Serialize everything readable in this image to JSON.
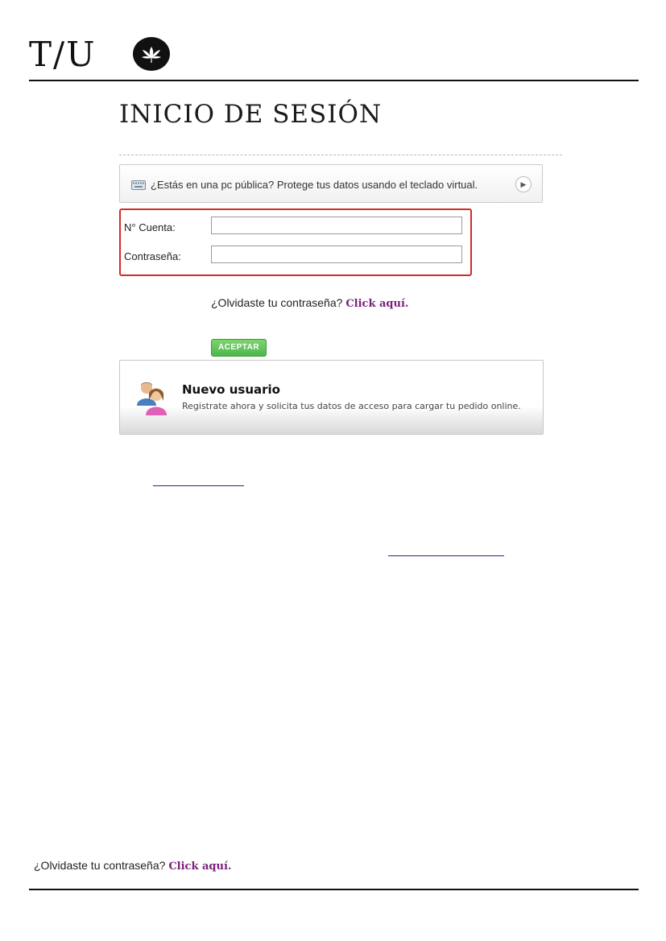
{
  "header": {
    "logo_text": "T/U",
    "emblem_icon": "lotus-emblem-icon"
  },
  "page": {
    "title": "INICIO DE SESIÓN"
  },
  "virtual_keyboard": {
    "icon": "keyboard-icon",
    "text": "¿Estás en una pc pública? Protege tus datos usando el teclado virtual.",
    "arrow_icon": "chevron-right-icon"
  },
  "login_form": {
    "account_label": "N° Cuenta:",
    "account_value": "",
    "password_label": "Contraseña:",
    "password_value": ""
  },
  "forgot_password": {
    "text": "¿Olvidaste tu contraseña?",
    "link": "Click aquí."
  },
  "submit": {
    "label": "ACEPTAR"
  },
  "new_user": {
    "icon": "users-icon",
    "title": "Nuevo usuario",
    "subtitle": "Registrate ahora y solicita tus datos de acceso para cargar tu pedido online."
  },
  "footer": {
    "forgot_text": "¿Olvidaste tu contraseña?",
    "forgot_link": "Click aquí."
  },
  "colors": {
    "form_border": "#d42a2a",
    "link": "#7a1f7a",
    "button": "#4cb84c"
  }
}
